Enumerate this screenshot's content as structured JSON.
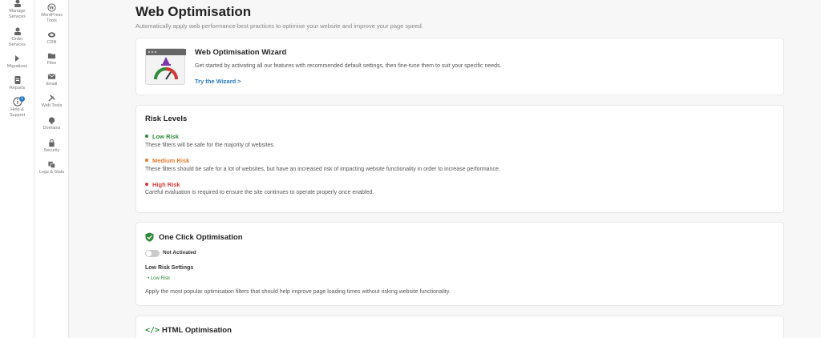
{
  "rail1": {
    "items": [
      {
        "label": "Manage\nServices",
        "icon": "services-icon"
      },
      {
        "label": "Order\nServices",
        "icon": "order-icon"
      },
      {
        "label": "Migrations",
        "icon": "migrations-icon"
      },
      {
        "label": "Reports",
        "icon": "reports-icon"
      },
      {
        "label": "Help &\nSupport",
        "icon": "help-icon",
        "badge": "1"
      }
    ]
  },
  "rail2": {
    "items": [
      {
        "label": "WordPress\nTools",
        "icon": "wordpress-icon"
      },
      {
        "label": "CDN",
        "icon": "cdn-icon"
      },
      {
        "label": "Files",
        "icon": "folder-icon"
      },
      {
        "label": "Email",
        "icon": "email-icon"
      },
      {
        "label": "Web Tools",
        "icon": "tools-icon"
      },
      {
        "label": "Domains",
        "icon": "domains-icon"
      },
      {
        "label": "Security",
        "icon": "lock-icon"
      },
      {
        "label": "Logs & Stats",
        "icon": "logs-icon"
      }
    ]
  },
  "page": {
    "title": "Web Optimisation",
    "subtitle": "Automatically apply web performance best practices to optimise your website and improve your page speed."
  },
  "wizard": {
    "title": "Web Optimisation Wizard",
    "description": "Get started by activating all our features with recommended default settings, then fine-tune them to suit your specific needs.",
    "link": "Try the Wizard >"
  },
  "risk": {
    "title": "Risk Levels",
    "levels": [
      {
        "label": "Low Risk",
        "color": "#2e8b3a",
        "description": "These filters will be safe for the majority of websites."
      },
      {
        "label": "Medium Risk",
        "color": "#e07b2e",
        "description": "These filters should be safe for a lot of websites, but have an increased risk of impacting website functionality in order to increase performance."
      },
      {
        "label": "High Risk",
        "color": "#d23a3a",
        "description": "Careful evaluation is required to ensure the site continues to operate properly once enabled."
      }
    ]
  },
  "oneclick": {
    "title": "One Click Optimisation",
    "toggle_label": "Not Activated",
    "settings_title": "Low Risk Settings",
    "risk_tag": "• Low Risk",
    "description": "Apply the most popular optimisation filters that should help improve page loading times without risking website functionality."
  },
  "html_opt": {
    "title": "HTML Optimisation",
    "icon": "</>"
  }
}
